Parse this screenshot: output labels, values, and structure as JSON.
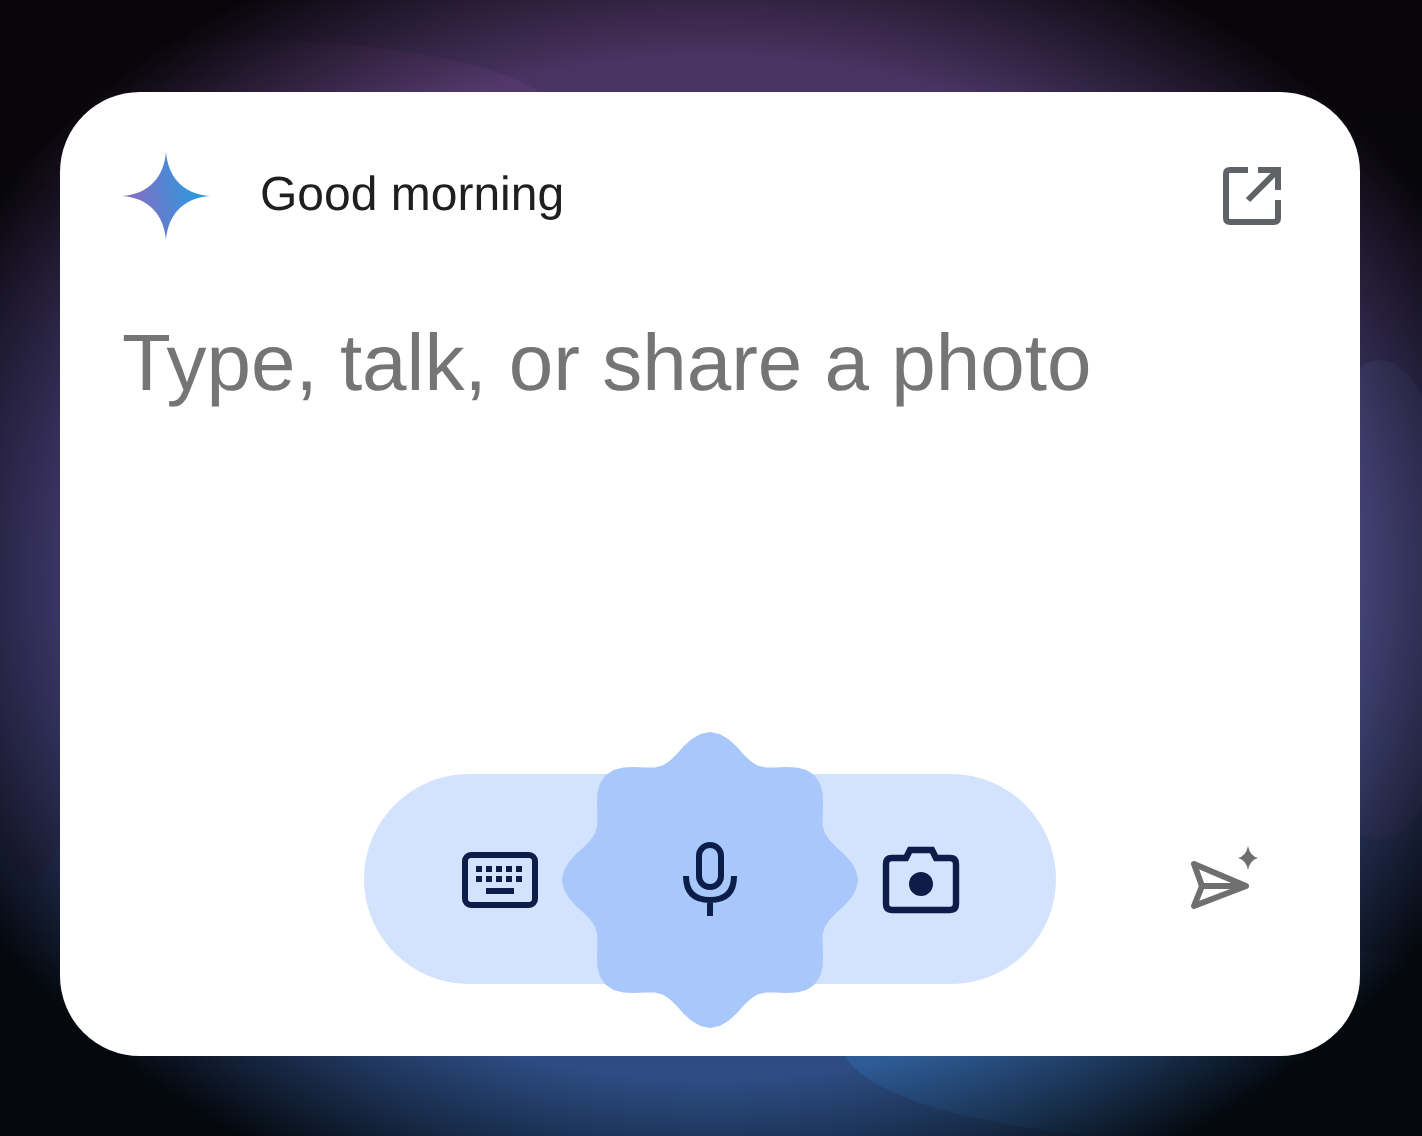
{
  "header": {
    "greeting": "Good morning"
  },
  "prompt": {
    "placeholder": "Type, talk, or share a photo"
  },
  "input_modes": [
    {
      "kind": "keyboard",
      "selected": false
    },
    {
      "kind": "microphone",
      "selected": true
    },
    {
      "kind": "camera",
      "selected": false
    }
  ]
}
